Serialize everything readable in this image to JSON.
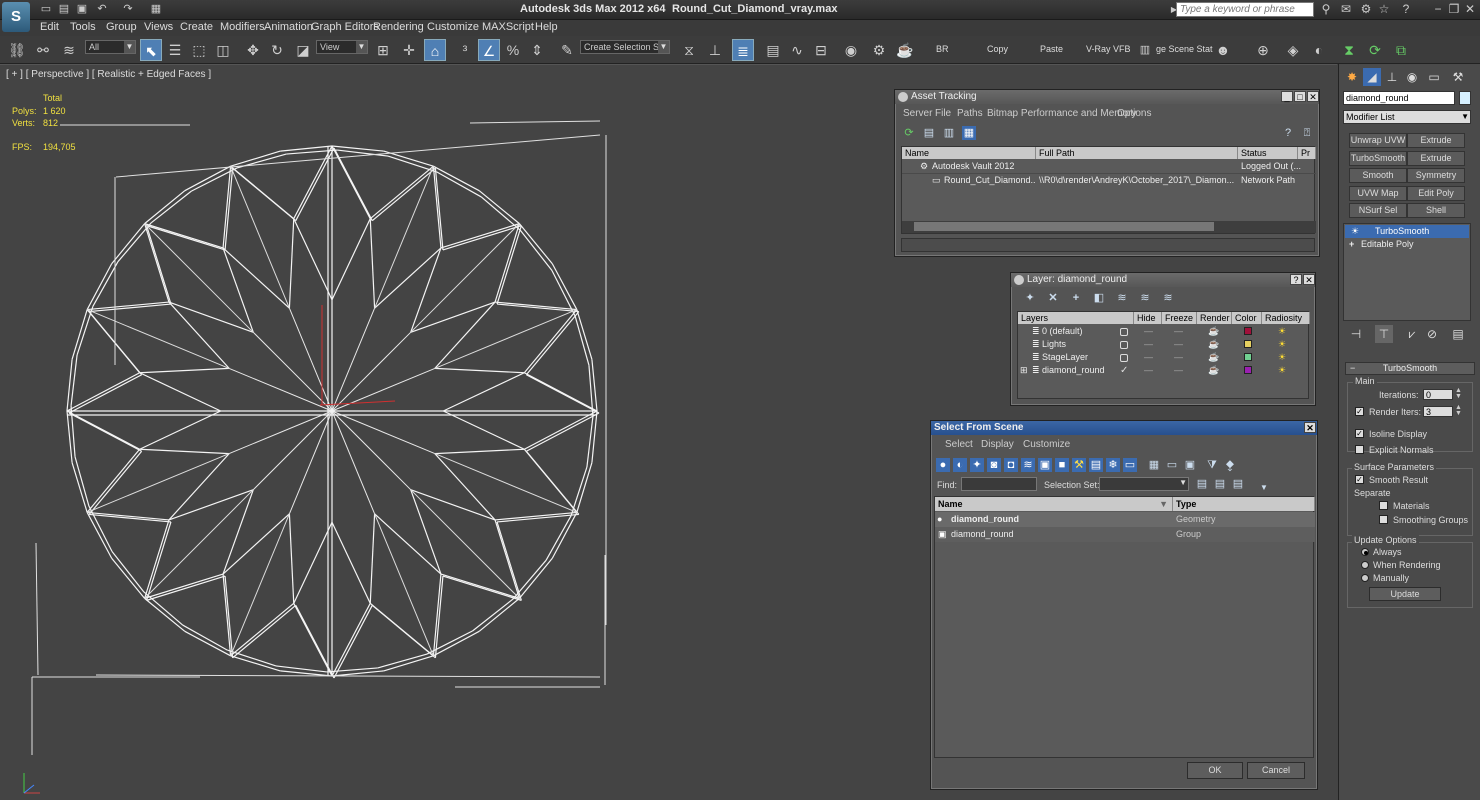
{
  "app": {
    "logo": "S",
    "title": "Autodesk 3ds Max  2012 x64",
    "file": "Round_Cut_Diamond_vray.max",
    "search_placeholder": "Type a keyword or phrase"
  },
  "menu": [
    "Edit",
    "Tools",
    "Group",
    "Views",
    "Create",
    "Modifiers",
    "Animation",
    "Graph Editors",
    "Rendering",
    "Customize",
    "MAXScript",
    "Help"
  ],
  "toolbar": {
    "filter_value": "All",
    "ref_coord_value": "View",
    "selection_set_placeholder": "Create Selection Se",
    "texts": [
      "BR",
      "Copy",
      "Paste",
      "V-Ray VFB",
      "ge Scene Stat"
    ]
  },
  "viewport": {
    "label": "[ + ] [ Perspective ] [ Realistic + Edged Faces ]",
    "stats": {
      "total_label": "Total",
      "polys_label": "Polys:",
      "polys": "1 620",
      "verts_label": "Verts:",
      "verts": "812",
      "fps_label": "FPS:",
      "fps": "194,705"
    }
  },
  "asset_tracking": {
    "title": "Asset Tracking",
    "menu": [
      "Server",
      "File",
      "Paths",
      "Bitmap Performance and Memory",
      "Options"
    ],
    "columns": [
      "Name",
      "Full Path",
      "Status",
      "Pr"
    ],
    "rows": [
      {
        "name": "Autodesk Vault 2012",
        "path": "",
        "status": "Logged Out (..."
      },
      {
        "name": "Round_Cut_Diamond...",
        "path": "\\\\R0\\d\\render\\AndreyK\\October_2017\\_Diamon...",
        "status": "Network Path"
      }
    ]
  },
  "layer_dialog": {
    "title": "Layer: diamond_round",
    "columns": [
      "Layers",
      "Hide",
      "Freeze",
      "Render",
      "Color",
      "Radiosity"
    ],
    "dash": "—",
    "layers": [
      {
        "name": "0 (default)",
        "color": "#a0103a"
      },
      {
        "name": "Lights",
        "color": "#e6d060"
      },
      {
        "name": "StageLayer",
        "color": "#70d090"
      },
      {
        "name": "diamond_round",
        "color": "#9a20b0"
      }
    ]
  },
  "select_scene": {
    "title": "Select From Scene",
    "menu": [
      "Select",
      "Display",
      "Customize"
    ],
    "find_label": "Find:",
    "selection_set_label": "Selection Set:",
    "columns": [
      "Name",
      "Type"
    ],
    "rows": [
      {
        "name": "diamond_round",
        "type": "Geometry"
      },
      {
        "name": "diamond_round",
        "type": "Group"
      }
    ],
    "ok": "OK",
    "cancel": "Cancel"
  },
  "command_panel": {
    "object_name": "diamond_round",
    "modifier_list": "Modifier List",
    "mod_buttons": [
      "Unwrap UVW",
      "Extrude",
      "TurboSmooth",
      "Extrude",
      "Smooth",
      "Symmetry",
      "UVW Map",
      "Edit Poly",
      "NSurf Sel",
      "Shell"
    ],
    "stack": [
      "TurboSmooth",
      "Editable Poly"
    ],
    "rollout_title": "TurboSmooth",
    "main_label": "Main",
    "iterations_label": "Iterations:",
    "iterations": "0",
    "render_iters_label": "Render Iters:",
    "render_iters": "3",
    "isoline_label": "Isoline Display",
    "explicit_normals_label": "Explicit Normals",
    "surface_params_label": "Surface Parameters",
    "smooth_result_label": "Smooth Result",
    "separate_label": "Separate",
    "materials_label": "Materials",
    "smoothing_groups_label": "Smoothing Groups",
    "update_options_label": "Update Options",
    "always_label": "Always",
    "when_rendering_label": "When Rendering",
    "manually_label": "Manually",
    "update_button": "Update"
  }
}
